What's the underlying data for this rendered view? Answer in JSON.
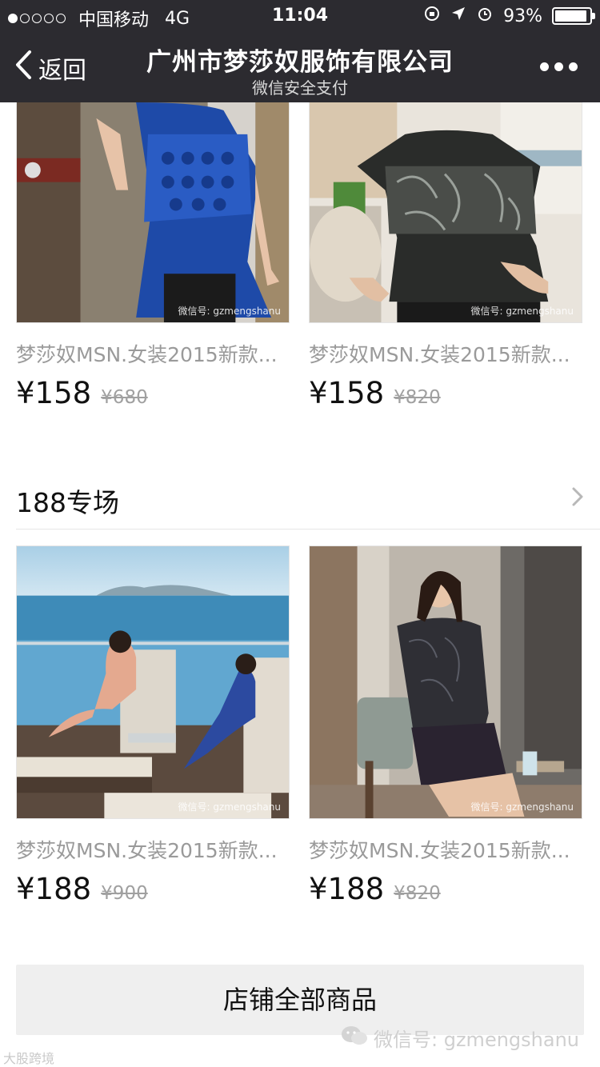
{
  "status_bar": {
    "carrier": "中国移动",
    "network": "4G",
    "time": "11:04",
    "battery": "93%",
    "battery_level": 0.93,
    "signal_bars": 1
  },
  "nav": {
    "back_label": "返回",
    "title": "广州市梦莎奴服饰有限公司",
    "subtitle": "微信安全支付"
  },
  "products_top": [
    {
      "name": "梦莎奴MSN.女装2015新款...",
      "price": "¥158",
      "original_price": "¥680",
      "watermark": "微信号: gzmengshanu"
    },
    {
      "name": "梦莎奴MSN.女装2015新款...",
      "price": "¥158",
      "original_price": "¥820",
      "watermark": "微信号: gzmengshanu"
    }
  ],
  "section": {
    "title": "188专场"
  },
  "products_bottom": [
    {
      "name": "梦莎奴MSN.女装2015新款...",
      "price": "¥188",
      "original_price": "¥900",
      "watermark": "微信号: gzmengshanu"
    },
    {
      "name": "梦莎奴MSN.女装2015新款...",
      "price": "¥188",
      "original_price": "¥820",
      "watermark": "微信号: gzmengshanu"
    }
  ],
  "all_products_button": "店铺全部商品",
  "footer_watermark": "微信号: gzmengshanu",
  "corner_mark": "大股跨境"
}
